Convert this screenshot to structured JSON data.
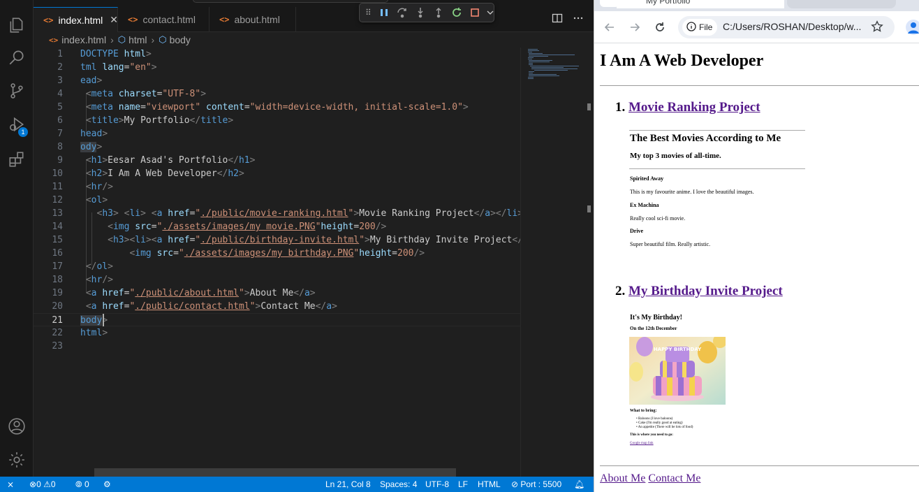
{
  "editor": {
    "tabs": [
      {
        "label": "index.html",
        "active": true
      },
      {
        "label": "contact.html",
        "active": false
      },
      {
        "label": "about.html",
        "active": false
      }
    ],
    "breadcrumb": [
      "index.html",
      "html",
      "body"
    ],
    "gutter": [
      "1",
      "2",
      "3",
      "4",
      "5",
      "6",
      "7",
      "8",
      "9",
      "10",
      "11",
      "12",
      "13",
      "14",
      "15",
      "16",
      "17",
      "18",
      "19",
      "20",
      "21",
      "22",
      "23"
    ],
    "current_line": "21"
  },
  "activity_bar": {
    "items": [
      "explorer-icon",
      "search-icon",
      "source-control-icon",
      "run-debug-icon",
      "extensions-icon"
    ],
    "debug_badge": "1",
    "bottom": [
      "account-icon",
      "settings-gear-icon"
    ]
  },
  "status_bar": {
    "errors": "0",
    "warnings": "0",
    "ports": "0",
    "position": "Ln 21, Col 8",
    "spaces": "Spaces: 4",
    "encoding": "UTF-8",
    "eol": "LF",
    "language": "HTML",
    "port": "Port : 5500"
  },
  "browser": {
    "tab_title": "My Portfolio",
    "url_chip": "File",
    "url": "C:/Users/ROSHAN/Desktop/w...",
    "page": {
      "h1": "I Am A Web Developer",
      "items": [
        {
          "number": "1.",
          "link": "Movie Ranking Project"
        },
        {
          "number": "2.",
          "link": "My Birthday Invite Project"
        }
      ],
      "movie_thumb": {
        "h1": "The Best Movies According to Me",
        "h3": "My top 3 movies of all-time.",
        "movies": [
          {
            "title": "Spirited Away",
            "text": "This is my favourite anime. I love the beautiful images."
          },
          {
            "title": "Ex Machina",
            "text": "Really cool sci-fi movie."
          },
          {
            "title": "Drive",
            "text": "Super beautiful film. Really artistic."
          }
        ]
      },
      "birthday_thumb": {
        "h1": "It's My Birthday!",
        "h2": "On the 12th December",
        "cake_text": "HAPPY BIRTHDAY",
        "bring_title": "What to bring:",
        "bring": [
          "Baloons (I love baloons)",
          "Cake (I'm really good at eating)",
          "An appetite (There will be lots of food)"
        ],
        "where": "This is where you need to go:",
        "map_link": "Google map link"
      },
      "footer_links": [
        "About Me",
        "Contact Me"
      ]
    }
  }
}
